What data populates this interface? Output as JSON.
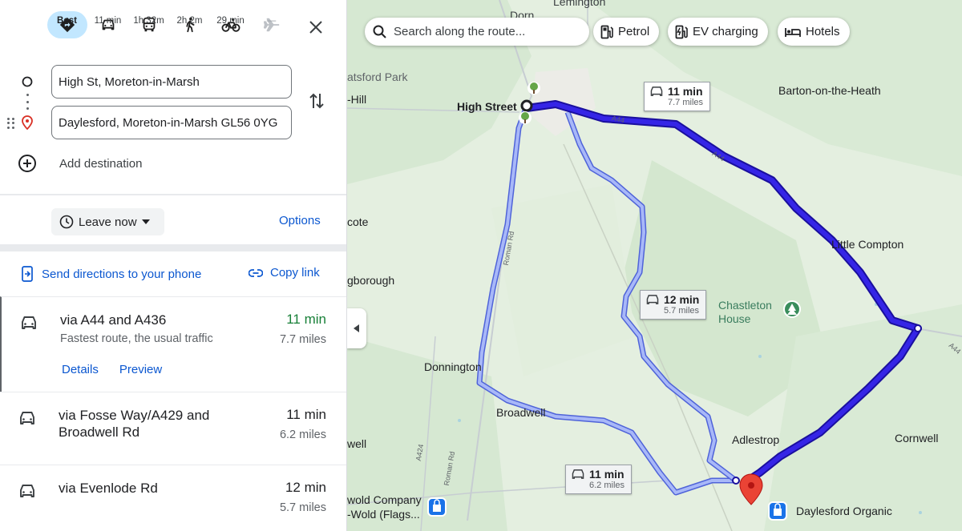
{
  "modes": [
    {
      "name": "best",
      "label": "Best"
    },
    {
      "name": "drive",
      "label": "11 min"
    },
    {
      "name": "transit",
      "label": "1h 32m"
    },
    {
      "name": "walk",
      "label": "2h 2m"
    },
    {
      "name": "cycle",
      "label": "29 min"
    },
    {
      "name": "flight",
      "label": "—"
    }
  ],
  "origin": "High St, Moreton-in-Marsh",
  "destination": "Daylesford, Moreton-in-Marsh GL56 0YG",
  "add_destination": "Add destination",
  "leave_now": "Leave now",
  "options": "Options",
  "send_to_phone": "Send directions to your phone",
  "copy_link": "Copy link",
  "routes": [
    {
      "via": "via A44 and A436",
      "desc": "Fastest route, the usual traffic",
      "time": "11 min",
      "distance": "7.7 miles",
      "details": "Details",
      "preview": "Preview"
    },
    {
      "via": "via Fosse Way/A429 and Broadwell Rd",
      "time": "11 min",
      "distance": "6.2 miles"
    },
    {
      "via": "via Evenlode Rd",
      "time": "12 min",
      "distance": "5.7 miles"
    }
  ],
  "map": {
    "search_placeholder": "Search along the route...",
    "chips": [
      "Petrol",
      "EV charging",
      "Hotels"
    ],
    "callouts": [
      {
        "time": "11 min",
        "distance": "7.7 miles"
      },
      {
        "time": "12 min",
        "distance": "5.7 miles"
      },
      {
        "time": "11 min",
        "distance": "6.2 miles"
      }
    ],
    "places": {
      "lemington": "Lemington",
      "dorn": "Dorn",
      "batsford_park": "atsford Park",
      "hill": "-Hill",
      "high_street": "High Street",
      "barton": "Barton-on-the-Heath",
      "cote": "cote",
      "little_compton": "Little Compton",
      "gborough": "gborough",
      "chastleton": "Chastleton House",
      "donnington": "Donnington",
      "broadwell": "Broadwell",
      "adlestrop": "Adlestrop",
      "cornwell": "Cornwell",
      "well": "well",
      "wold_company": "wold Company",
      "wold_flags": "-Wold (Flags...",
      "daylesford_organic": "Daylesford Organic"
    },
    "roads": [
      "A44",
      "A44",
      "Roman Rd",
      "A424",
      "Roman Rd",
      "A44"
    ]
  },
  "colors": {
    "route_selected": "#2b21d4",
    "route_alt": "#7a8cf2",
    "link": "#0b57d0",
    "fast_time": "#188038",
    "pin": "#ea4335"
  }
}
